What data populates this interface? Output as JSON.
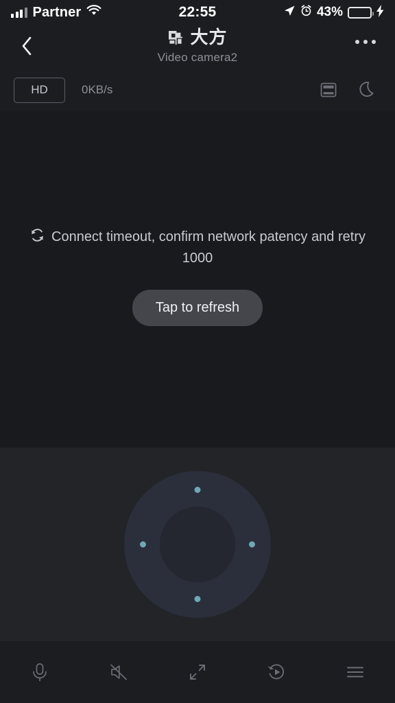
{
  "status_bar": {
    "carrier": "Partner",
    "time": "22:55",
    "battery_percent": "43%",
    "battery_level": 43,
    "signal_icon": "cellular-bars-icon",
    "wifi_icon": "wifi-icon",
    "location_icon": "location-arrow-icon",
    "alarm_icon": "alarm-clock-icon",
    "battery_icon": "battery-icon",
    "charging_icon": "lightning-bolt-icon",
    "battery_fill_color": "#3ad24a"
  },
  "nav": {
    "back_icon": "back-chevron-icon",
    "brand_logo_icon": "dafang-logo-icon",
    "brand_name": "大方",
    "subtitle": "Video camera2",
    "more_icon": "more-options-icon"
  },
  "quality_row": {
    "hd_label": "HD",
    "bitrate": "0KB/s",
    "snapshot_icon": "snapshot-icon",
    "night_mode_icon": "moon-icon"
  },
  "video": {
    "refresh_status_icon": "sync-refresh-icon",
    "message": "Connect timeout, confirm network patency and retry 1000",
    "refresh_button_label": "Tap to refresh"
  },
  "dpad": {
    "name": "direction-pad",
    "dot_color": "#6fa8b5",
    "directions": [
      "up",
      "right",
      "down",
      "left"
    ]
  },
  "toolbar": {
    "items": [
      {
        "name": "microphone-icon",
        "label": "Microphone"
      },
      {
        "name": "speaker-muted-icon",
        "label": "Sound muted"
      },
      {
        "name": "fullscreen-expand-icon",
        "label": "Fullscreen"
      },
      {
        "name": "playback-history-icon",
        "label": "Playback"
      },
      {
        "name": "menu-hamburger-icon",
        "label": "More"
      }
    ]
  },
  "colors": {
    "app_background": "#1c1d21",
    "video_background": "#191a1e",
    "dpad_background": "#232428",
    "accent_dot": "#6fa8b5",
    "text_primary": "#e6e7ea",
    "text_secondary": "#8d9097"
  }
}
